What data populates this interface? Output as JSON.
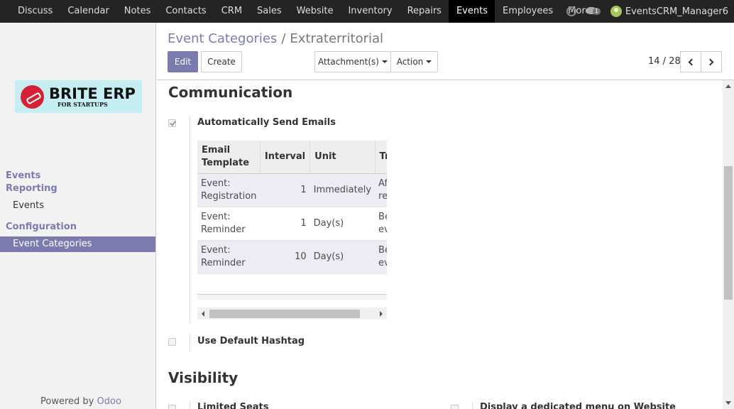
{
  "topbar": {
    "menu": [
      "Discuss",
      "Calendar",
      "Notes",
      "Contacts",
      "CRM",
      "Sales",
      "Website",
      "Inventory",
      "Repairs",
      "Events",
      "Employees"
    ],
    "active": "Events",
    "more_label": "More",
    "chat_count": "1",
    "user_name": "EventsCRM_Manager6"
  },
  "sidebar": {
    "logo_text": "BRITE ERP",
    "logo_subtext": "FOR STARTUPS",
    "section_events": "Events",
    "section_reporting": "Reporting",
    "item_events": "Events",
    "section_configuration": "Configuration",
    "item_event_categories": "Event Categories",
    "powered_prefix": "Powered by",
    "powered_brand": "Odoo"
  },
  "control_panel": {
    "breadcrumb_parent": "Event Categories",
    "breadcrumb_sep": "/",
    "breadcrumb_current": "Extraterritorial",
    "edit_label": "Edit",
    "create_label": "Create",
    "attachments_label": "Attachment(s)",
    "action_label": "Action",
    "pager": "14 / 28"
  },
  "form": {
    "communication_title": "Communication",
    "auto_send_label": "Automatically Send Emails",
    "auto_send_checked": true,
    "table": {
      "headers": [
        "Email Template",
        "Interval",
        "Unit",
        "Trigger"
      ],
      "rows": [
        {
          "template": "Event: Registration",
          "interval": "1",
          "unit": "Immediately",
          "trigger": "After each registration"
        },
        {
          "template": "Event: Reminder",
          "interval": "1",
          "unit": "Day(s)",
          "trigger": "Before the event"
        },
        {
          "template": "Event: Reminder",
          "interval": "10",
          "unit": "Day(s)",
          "trigger": "Before the event"
        }
      ]
    },
    "default_hashtag_label": "Use Default Hashtag",
    "default_hashtag_checked": false,
    "visibility_title": "Visibility",
    "limited_seats_label": "Limited Seats",
    "website_menu_label": "Display a dedicated menu on Website"
  }
}
